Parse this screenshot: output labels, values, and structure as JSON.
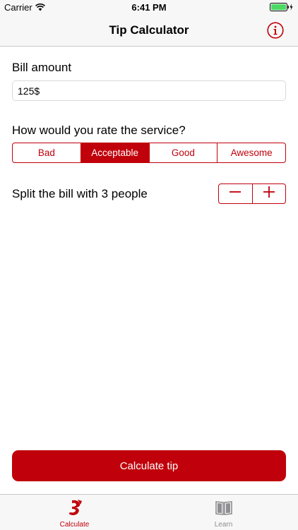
{
  "status_bar": {
    "carrier": "Carrier",
    "time": "6:41 PM"
  },
  "nav": {
    "title": "Tip Calculator",
    "info_icon": "info-icon"
  },
  "bill": {
    "label": "Bill amount",
    "value": "125$"
  },
  "rating": {
    "label": "How would you rate the service?",
    "options": [
      "Bad",
      "Acceptable",
      "Good",
      "Awesome"
    ],
    "selected": "Acceptable"
  },
  "split": {
    "label": "Split the bill with 3 people",
    "decrement_icon": "minus-icon",
    "increment_icon": "plus-icon"
  },
  "calculate_button": {
    "label": "Calculate tip"
  },
  "tabs": [
    {
      "label": "Calculate",
      "icon": "calculate-icon",
      "active": true
    },
    {
      "label": "Learn",
      "icon": "book-icon",
      "active": false
    }
  ],
  "colors": {
    "accent": "#c0000a",
    "inactive": "#8e8e93",
    "bar_background": "#f7f7f7"
  }
}
